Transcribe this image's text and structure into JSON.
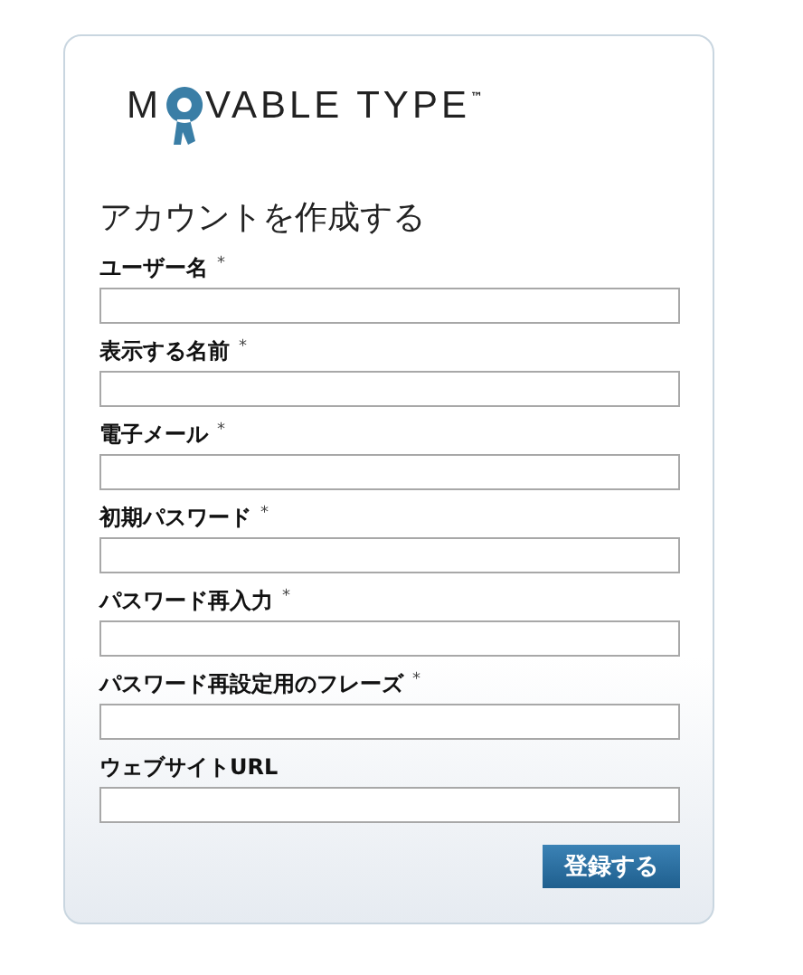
{
  "logo": {
    "before": "M",
    "after": "VABLE TYPE",
    "mark": "™"
  },
  "title": "アカウントを作成する",
  "fields": [
    {
      "label": "ユーザー名",
      "required_mark": "*"
    },
    {
      "label": "表示する名前",
      "required_mark": "*"
    },
    {
      "label": "電子メール",
      "required_mark": "*"
    },
    {
      "label": "初期パスワード",
      "required_mark": "*"
    },
    {
      "label": "パスワード再入力",
      "required_mark": "*"
    },
    {
      "label": "パスワード再設定用のフレーズ",
      "required_mark": "*"
    },
    {
      "label": "ウェブサイトURL"
    }
  ],
  "submit": "登録する"
}
